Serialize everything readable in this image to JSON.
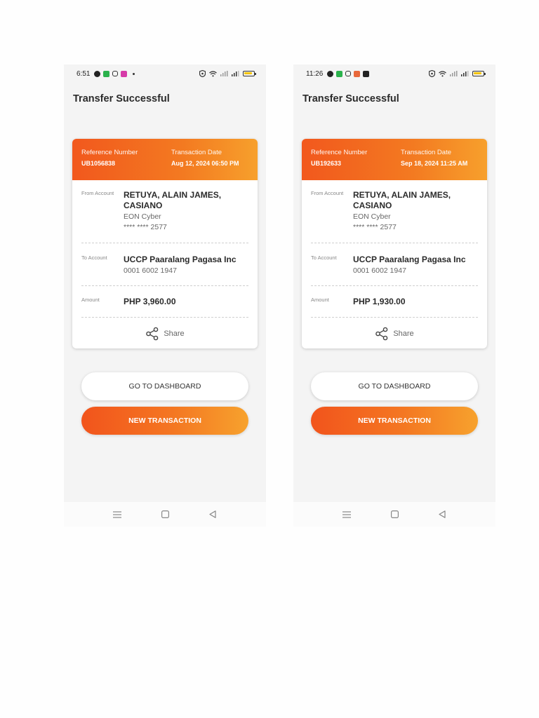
{
  "screens": [
    {
      "status_time": "6:51",
      "title": "Transfer Successful",
      "reference_label": "Reference Number",
      "reference_value": "UB1056838",
      "date_label": "Transaction Date",
      "date_value": "Aug 12, 2024 06:50 PM",
      "from_label": "From Account",
      "from_name": "RETUYA, ALAIN JAMES, CASIANO",
      "from_bank": "EON Cyber",
      "from_account": "**** **** 2577",
      "to_label": "To Account",
      "to_name": "UCCP Paaralang Pagasa Inc",
      "to_account": "0001 6002 1947",
      "amount_label": "Amount",
      "amount_value": "PHP 3,960.00",
      "share_label": "Share",
      "dashboard_button": "GO TO DASHBOARD",
      "new_transaction_button": "NEW TRANSACTION"
    },
    {
      "status_time": "11:26",
      "title": "Transfer Successful",
      "reference_label": "Reference Number",
      "reference_value": "UB192633",
      "date_label": "Transaction Date",
      "date_value": "Sep 18, 2024 11:25 AM",
      "from_label": "From Account",
      "from_name": "RETUYA, ALAIN JAMES, CASIANO",
      "from_bank": "EON Cyber",
      "from_account": "**** **** 2577",
      "to_label": "To Account",
      "to_name": "UCCP Paaralang Pagasa Inc",
      "to_account": "0001 6002 1947",
      "amount_label": "Amount",
      "amount_value": "PHP 1,930.00",
      "share_label": "Share",
      "dashboard_button": "GO TO DASHBOARD",
      "new_transaction_button": "NEW TRANSACTION"
    }
  ],
  "theme": {
    "accent_start": "#f2581d",
    "accent_end": "#f7a02c"
  },
  "icons": {
    "share": "share-icon",
    "nav_menu": "menu-icon",
    "nav_home": "home-icon",
    "nav_back": "back-icon"
  }
}
